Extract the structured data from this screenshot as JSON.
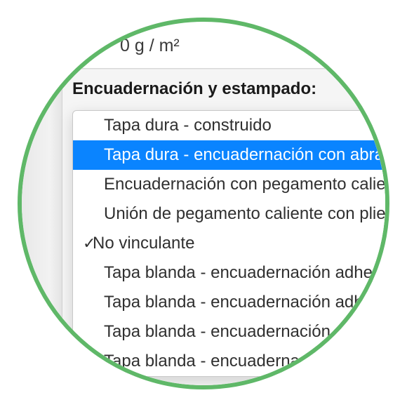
{
  "topLine": "0 g / m²",
  "sectionLabel": "Encuadernación y estampado:",
  "dropdown": {
    "options": [
      {
        "label": "Tapa dura - construido",
        "highlighted": false,
        "checked": false
      },
      {
        "label": "Tapa dura - encuadernación con abra",
        "highlighted": true,
        "checked": false
      },
      {
        "label": "Encuadernación con pegamento calie",
        "highlighted": false,
        "checked": false
      },
      {
        "label": "Unión de pegamento caliente con plie",
        "highlighted": false,
        "checked": false
      },
      {
        "label": "No vinculante",
        "highlighted": false,
        "checked": true
      },
      {
        "label": "Tapa blanda - encuadernación adhes",
        "highlighted": false,
        "checked": false
      },
      {
        "label": "Tapa blanda - encuadernación adhe",
        "highlighted": false,
        "checked": false
      },
      {
        "label": "Tapa blanda - encuadernación ad",
        "highlighted": false,
        "checked": false
      },
      {
        "label": "Tapa blanda - encuadernación",
        "highlighted": false,
        "checked": false
      }
    ]
  }
}
